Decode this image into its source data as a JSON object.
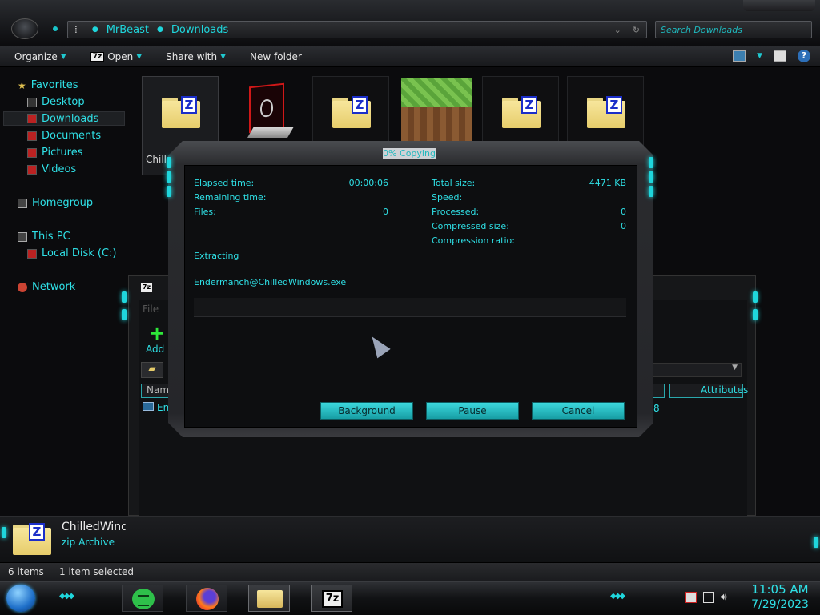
{
  "address": {
    "segments": [
      "MrBeast",
      "Downloads"
    ]
  },
  "search": {
    "placeholder": "Search Downloads"
  },
  "toolbar": {
    "organize": "Organize",
    "open": "Open",
    "open_badge": "7z",
    "share": "Share with",
    "new_folder": "New folder",
    "help": "?"
  },
  "sidebar": {
    "favorites": "Favorites",
    "items": [
      "Desktop",
      "Downloads",
      "Documents",
      "Pictures",
      "Videos"
    ],
    "homegroup": "Homegroup",
    "this_pc": "This PC",
    "local_disk": "Local Disk (C:)",
    "network": "Network",
    "star": "★"
  },
  "files": {
    "selected_label": "Chille",
    "zip_letter": "Z"
  },
  "archive_window": {
    "title_badge": "7z",
    "menu_file": "File",
    "add_label": "Add",
    "add_glyph": "+",
    "col_name": "Nam",
    "col_attributes": "Attributes",
    "row_name": "En",
    "row_num": "8"
  },
  "dialog": {
    "title": "0% Copying",
    "elapsed_label": "Elapsed time:",
    "elapsed_value": "00:00:06",
    "remaining_label": "Remaining time:",
    "files_label": "Files:",
    "files_value": "0",
    "total_size_label": "Total size:",
    "total_size_value": "4471 KB",
    "speed_label": "Speed:",
    "processed_label": "Processed:",
    "processed_value": "0",
    "compressed_label": "Compressed size:",
    "compressed_value": "0",
    "ratio_label": "Compression ratio:",
    "operation": "Extracting",
    "current_file": "Endermanch@ChilledWindows.exe",
    "progress": 0,
    "buttons": {
      "background": "Background",
      "pause": "Pause",
      "cancel": "Cancel"
    }
  },
  "details": {
    "name": "ChilledWindo",
    "type": "zip Archive"
  },
  "status": {
    "items": "6 items",
    "selected": "1 item selected"
  },
  "taskbar": {
    "sevenzip_badge": "7z",
    "time": "11:05 AM",
    "date": "7/29/2023"
  },
  "colors": {
    "accent": "#1fd6dc",
    "button": "#2bc3c9",
    "background": "#0b0b0d"
  }
}
